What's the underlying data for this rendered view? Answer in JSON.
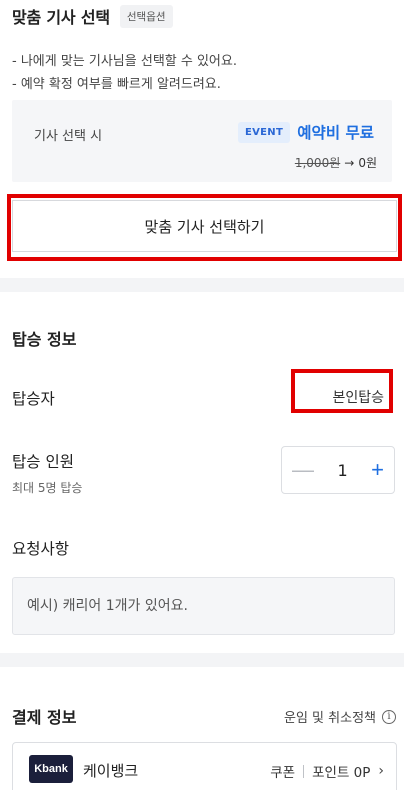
{
  "driver_select": {
    "title": "맞춤 기사 선택",
    "option_badge": "선택옵션",
    "desc_line1": "- 나에게 맞는 기사님을 선택할 수 있어요.",
    "desc_line2": "- 예약 확정 여부를 빠르게 알려드려요.",
    "event": {
      "label": "기사 선택 시",
      "badge": "EVENT",
      "headline": "예약비 무료",
      "old_price": "1,000원",
      "arrow": "→",
      "new_price": "0원"
    },
    "button_label": "맞춤 기사 선택하기"
  },
  "boarding": {
    "title": "탑승 정보",
    "passenger_label": "탑승자",
    "passenger_value": "본인탑승",
    "count_label": "탑승 인원",
    "count_sub": "최대 5명 탑승",
    "count_value": "1",
    "minus_symbol": "—",
    "plus_symbol": "+",
    "request_label": "요청사항",
    "request_placeholder": "예시) 캐리어 1개가 있어요."
  },
  "payment": {
    "title": "결제 정보",
    "policy_link": "운임 및 취소정책",
    "info_icon": "ⓘ",
    "bank_logo": "Kbank",
    "bank_name": "케이뱅크",
    "coupon": "쿠폰",
    "points": "포인트 0P",
    "chevron": "›"
  },
  "colors": {
    "accent": "#1f6fe0",
    "highlight": "#e10000",
    "divider": "#f3f4f6"
  }
}
